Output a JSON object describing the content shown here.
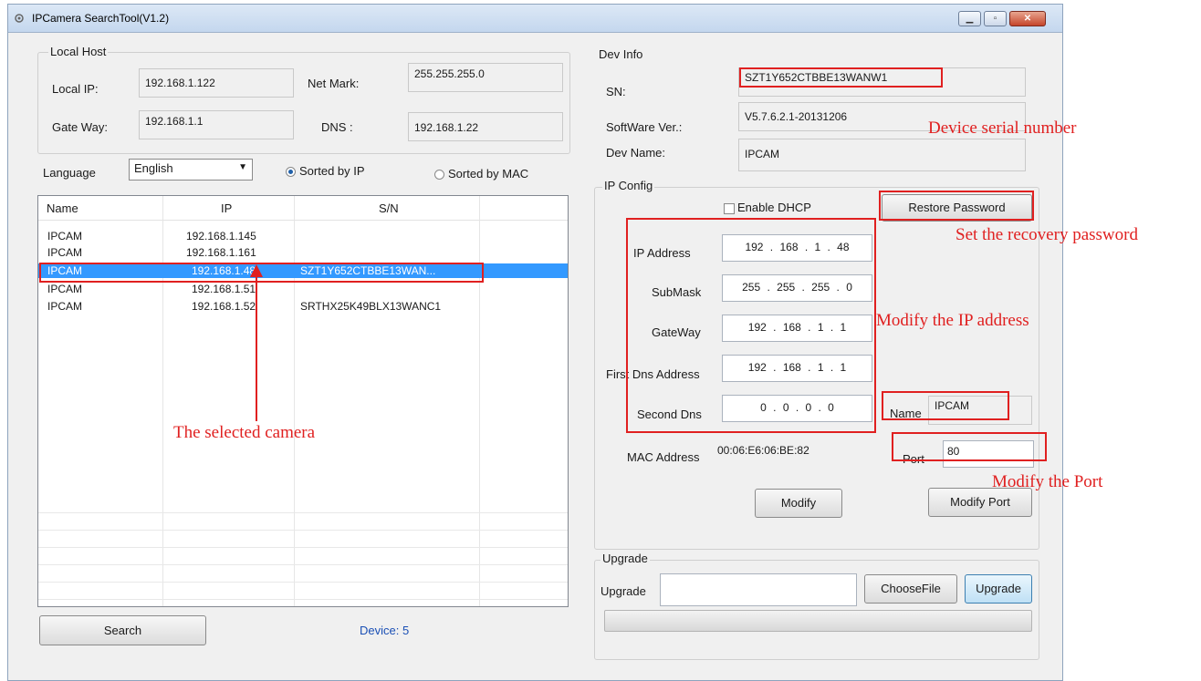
{
  "window": {
    "title": "IPCamera SearchTool(V1.2)"
  },
  "local_host": {
    "legend": "Local Host",
    "local_ip_label": "Local IP:",
    "local_ip": "192.168.1.122",
    "net_mask_label": "Net Mark:",
    "net_mask": "255.255.255.0",
    "gateway_label": "Gate Way:",
    "gateway": "192.168.1.1",
    "dns_label": "DNS :",
    "dns": "192.168.1.22"
  },
  "language": {
    "label": "Language",
    "selected": "English"
  },
  "sort": {
    "by_ip": "Sorted by IP",
    "by_mac": "Sorted by MAC",
    "selected": "by_ip"
  },
  "device_list": {
    "columns": [
      "Name",
      "IP",
      "S/N"
    ],
    "rows": [
      {
        "name": "IPCAM",
        "ip": "192.168.1.145",
        "sn": ""
      },
      {
        "name": "IPCAM",
        "ip": "192.168.1.161",
        "sn": ""
      },
      {
        "name": "IPCAM",
        "ip": "192.168.1.48",
        "sn": "SZT1Y652CTBBE13WAN..."
      },
      {
        "name": "IPCAM",
        "ip": "192.168.1.51",
        "sn": ""
      },
      {
        "name": "IPCAM",
        "ip": "192.168.1.52",
        "sn": "SRTHX25K49BLX13WANC1"
      }
    ],
    "selected_index": 2
  },
  "search_button": "Search",
  "device_count": "Device: 5",
  "dev_info": {
    "legend": "Dev Info",
    "sn_label": "SN:",
    "sn": "SZT1Y652CTBBE13WANW1",
    "software_label": "SoftWare Ver.:",
    "software": "V5.7.6.2.1-20131206",
    "devname_label": "Dev Name:",
    "devname": "IPCAM"
  },
  "ip_config": {
    "legend": "IP Config",
    "dhcp_label": "Enable DHCP",
    "restore_button": "Restore Password",
    "ip_label": "IP Address",
    "ip": "192 . 168 .   1  .  48",
    "mask_label": "SubMask",
    "mask": "255 . 255 . 255 .  0",
    "gateway_label": "GateWay",
    "gateway": "192 . 168 .   1  .  1",
    "dns1_label": "First Dns Address",
    "dns1": "192 . 168 .   1  .  1",
    "dns2_label": "Second Dns",
    "dns2": "0  .   0  .   0  .  0",
    "name_label": "Name",
    "name": "IPCAM",
    "mac_label": "MAC Address",
    "mac": "00:06:E6:06:BE:82",
    "port_label": "Port",
    "port": "80",
    "modify_button": "Modify",
    "modify_port_button": "Modify Port"
  },
  "upgrade": {
    "legend": "Upgrade",
    "label": "Upgrade",
    "file": "",
    "choose_button": "ChooseFile",
    "upgrade_button": "Upgrade",
    "progress": 0
  },
  "annotations": {
    "serial": "Device serial number",
    "recovery": "Set the recovery password",
    "modify_ip": "Modify  the IP address",
    "selected": "The selected camera",
    "modify_port": "Modify the Port"
  },
  "colors": {
    "highlight": "#e02020",
    "selection": "#3399ff"
  }
}
